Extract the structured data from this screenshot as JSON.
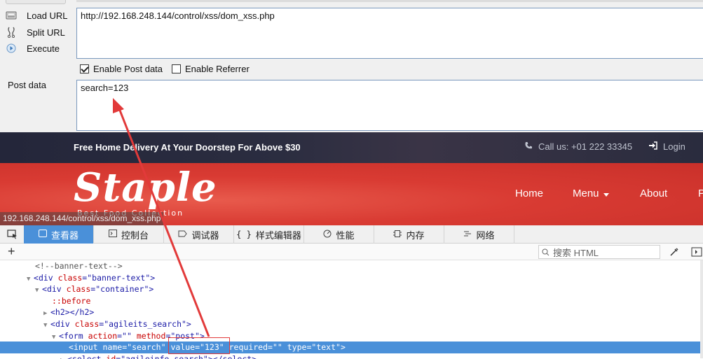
{
  "hackbar": {
    "actions": [
      {
        "label": "Load URL",
        "icon": "load-url-icon"
      },
      {
        "label": "Split URL",
        "icon": "split-url-icon"
      },
      {
        "label": "Execute",
        "icon": "execute-icon"
      }
    ],
    "url_value": "http://192.168.248.144/control/xss/dom_xss.php",
    "enable_post_label": "Enable Post data",
    "enable_post_checked": true,
    "enable_referrer_label": "Enable Referrer",
    "enable_referrer_checked": false,
    "post_label": "Post data",
    "post_value": "search=123"
  },
  "site": {
    "promo": "Free Home Delivery At Your Doorstep For Above $30",
    "call": "Call us: +01 222 33345",
    "login": "Login",
    "logo": "Staple",
    "tagline": "Best Food Collection",
    "nav": [
      "Home",
      "Menu",
      "About",
      "P"
    ],
    "status_url": "192.168.248.144/control/xss/dom_xss.php",
    "colors": {
      "topbar": "#2a2c3e",
      "hero": "#d93b33"
    }
  },
  "devtools": {
    "tabs": [
      {
        "label": "查看器",
        "icon": "inspector-icon",
        "active": true
      },
      {
        "label": "控制台",
        "icon": "console-icon",
        "active": false
      },
      {
        "label": "调试器",
        "icon": "debugger-icon",
        "active": false
      },
      {
        "label": "样式编辑器",
        "icon": "style-editor-icon",
        "active": false
      },
      {
        "label": "性能",
        "icon": "performance-icon",
        "active": false
      },
      {
        "label": "内存",
        "icon": "memory-icon",
        "active": false
      },
      {
        "label": "网络",
        "icon": "network-icon",
        "active": false
      }
    ],
    "search_placeholder": "搜索 HTML",
    "tree": {
      "r0": "<!--banner-text-->",
      "r1_tag": "div",
      "r1_attr": "class",
      "r1_val": "banner-text",
      "r2_tag": "div",
      "r2_attr": "class",
      "r2_val": "container",
      "r3": "::before",
      "r4": "<h2></h2>",
      "r5_tag": "div",
      "r5_attr": "class",
      "r5_val": "agileits_search",
      "r6_tag": "form",
      "r6_a1": "action",
      "r6_v1": "",
      "r6_a2": "method",
      "r6_v2": "post",
      "r7_tag": "input",
      "r7_a1": "name",
      "r7_v1": "search",
      "r7_a2": "value",
      "r7_v2": "123",
      "r7_a3": "required",
      "r7_v3": "",
      "r7_a4": "type",
      "r7_v4": "text",
      "r8_tag": "select",
      "r8_attr": "id",
      "r8_val": "agileinfo_search",
      "r8_close": "</select>"
    },
    "accent": "#4a90d9"
  },
  "annotation_color": "#e23a3a"
}
